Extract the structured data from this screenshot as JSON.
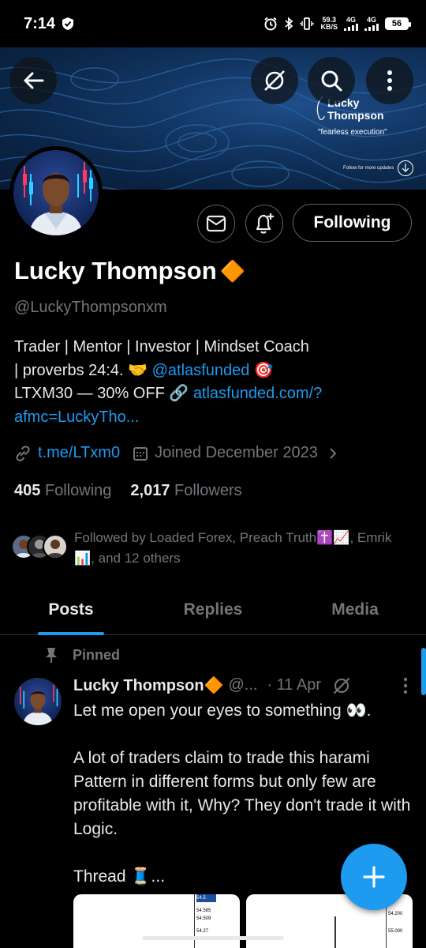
{
  "status_bar": {
    "time": "7:14",
    "net_speed_value": "59.3",
    "net_speed_unit": "KB/S",
    "signal1": "4G",
    "signal2": "4G",
    "battery": "56"
  },
  "banner": {
    "brand_line1": "Lucky",
    "brand_line2": "Thompson",
    "tagline": "\"fearless execution\"",
    "follow_note": "Follow for more updates"
  },
  "profile": {
    "display_name": "Lucky Thompson",
    "verified_emoji": "🔶",
    "handle": "@LuckyThompsonxm",
    "bio_line1": "Trader | Mentor | Investor | Mindset Coach",
    "bio_line2_pre": "| proverbs 24:4. 🤝 ",
    "bio_mention": "@atlasfunded",
    "bio_line2_post": " 🎯",
    "bio_line3_pre": "LTXM30 — 30% OFF 🔗 ",
    "bio_url": "atlasfunded.com/?",
    "bio_url_cont": "afmc=LuckyTho...",
    "website": "t.me/LTxm0",
    "joined": "Joined December 2023",
    "following_count": "405",
    "following_label": "Following",
    "followers_count": "2,017",
    "followers_label": "Followers",
    "followed_by": "Followed by Loaded Forex, Preach Truth✝️📈, Emrik📊, and 12 others",
    "following_button": "Following"
  },
  "tabs": [
    {
      "label": "Posts",
      "active": true
    },
    {
      "label": "Replies",
      "active": false
    },
    {
      "label": "Media",
      "active": false
    }
  ],
  "post": {
    "pinned_label": "Pinned",
    "author_name": "Lucky Thompson🔶",
    "author_handle": "@...",
    "date": "· 11 Apr",
    "text": "Let me  open your eyes to something 👀.\n\nA lot of traders claim to trade this harami Pattern in different forms but only few are profitable with it, Why? They don't trade it with Logic.\n\nThread 🧵...",
    "media_labels": [
      "54.5",
      "54.585",
      "54.509",
      "54.27",
      "54.200",
      "55.000"
    ]
  },
  "colors": {
    "accent": "#1d9bf0",
    "background": "#000000",
    "muted_text": "#71767b",
    "primary_text": "#e7e9ea"
  },
  "icons": [
    "back-arrow-icon",
    "grok-icon",
    "search-icon",
    "more-vertical-icon",
    "mail-icon",
    "bell-plus-icon",
    "link-icon",
    "calendar-icon",
    "chevron-right-icon",
    "pin-icon",
    "plus-icon"
  ]
}
